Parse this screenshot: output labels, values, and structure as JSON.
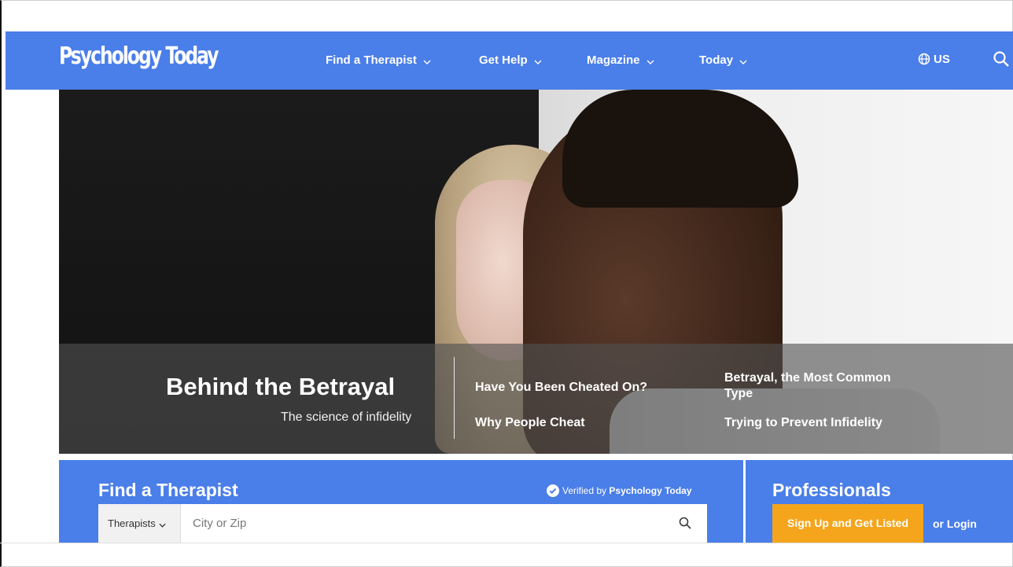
{
  "brand": {
    "logo": "Psychology Today",
    "primary_color": "#4a7ee8",
    "accent_color": "#f4a51c"
  },
  "nav": {
    "items": [
      {
        "label": "Find a Therapist",
        "icon": "chevron-down-icon"
      },
      {
        "label": "Get Help",
        "icon": "chevron-down-icon"
      },
      {
        "label": "Magazine",
        "icon": "chevron-down-icon"
      },
      {
        "label": "Today",
        "icon": "chevron-down-icon"
      }
    ],
    "region": {
      "label": "US",
      "icon": "globe-icon"
    },
    "search_icon": "search-icon"
  },
  "hero": {
    "title": "Behind the Betrayal",
    "subtitle": "The science of infidelity",
    "links": [
      "Have You Been Cheated On?",
      "Why People Cheat",
      "Betrayal, the Most Common Type",
      "Trying to Prevent Infidelity"
    ]
  },
  "find_therapist": {
    "title": "Find a Therapist",
    "verified_prefix": "Verified by",
    "verified_brand": "Psychology Today",
    "selector": {
      "value": "Therapists",
      "icon": "chevron-down-icon"
    },
    "input": {
      "placeholder": "City or Zip",
      "value": ""
    },
    "search_icon": "search-icon",
    "verified_icon": "check-circle-icon"
  },
  "professionals": {
    "title": "Professionals",
    "signup_label": "Sign Up and Get Listed",
    "login_label": "or Login"
  }
}
